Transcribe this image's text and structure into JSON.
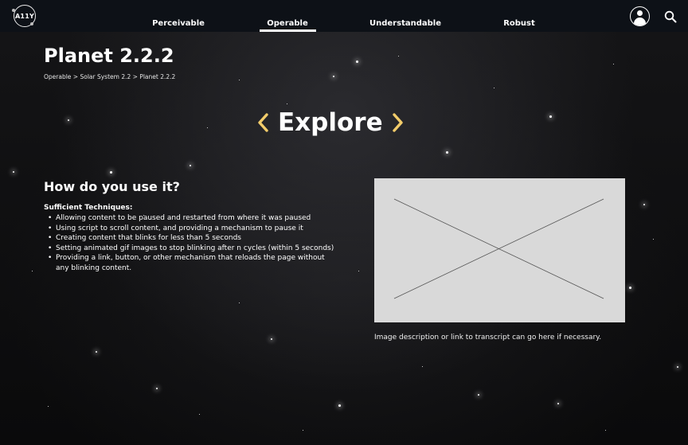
{
  "logo": {
    "text": "A11Y"
  },
  "nav": {
    "items": [
      {
        "label": "Perceivable"
      },
      {
        "label": "Operable",
        "active": true
      },
      {
        "label": "Understandable"
      },
      {
        "label": "Robust"
      }
    ],
    "icons": [
      "profile-icon",
      "search-icon"
    ]
  },
  "page": {
    "title": "Planet 2.2.2",
    "breadcrumb": "Operable > Solar System 2.2 > Planet 2.2.2"
  },
  "explore": {
    "label": "Explore",
    "prev_icon": "chevron-left-icon",
    "next_icon": "chevron-right-icon",
    "accent_color": "#f2cc6a"
  },
  "section": {
    "heading": "How do you use it?",
    "techniques_title": "Sufficient Techniques:",
    "techniques": [
      "Allowing content to be paused and restarted from where it was paused",
      "Using script to scroll content, and providing a mechanism to pause it",
      "Creating content that blinks for less than 5 seconds",
      "Setting animated gif images to stop blinking after n cycles (within 5 seconds)",
      "Providing a link, button, or other mechanism that reloads the page without any blinking content."
    ]
  },
  "media": {
    "caption": "Image description or link to transcript can go here if necessary."
  },
  "colors": {
    "topbar": "#0d1117",
    "background": "#0b0b0d",
    "placeholder": "#d9d9d9"
  }
}
